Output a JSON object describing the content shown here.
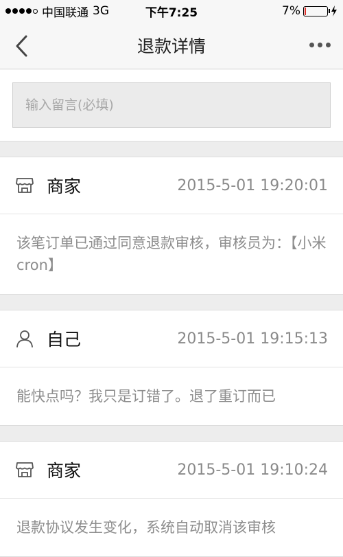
{
  "status_bar": {
    "carrier": "中国联通",
    "network": "3G",
    "time": "下午7:25",
    "battery_text": "7%",
    "battery_level": 0.07
  },
  "nav": {
    "title": "退款详情"
  },
  "message_input": {
    "placeholder": "输入留言(必填)",
    "value": ""
  },
  "records": [
    {
      "role": "商家",
      "role_icon": "store-icon",
      "time": "2015-5-01 19:20:01",
      "content": "该笔订单已通过同意退款审核，审核员为：【小米cron】"
    },
    {
      "role": "自己",
      "role_icon": "person-icon",
      "time": "2015-5-01 19:15:13",
      "content": "能快点吗？我只是订错了。退了重订而已"
    },
    {
      "role": "商家",
      "role_icon": "store-icon",
      "time": "2015-5-01 19:10:24",
      "content": "退款协议发生变化，系统自动取消该审核"
    }
  ]
}
